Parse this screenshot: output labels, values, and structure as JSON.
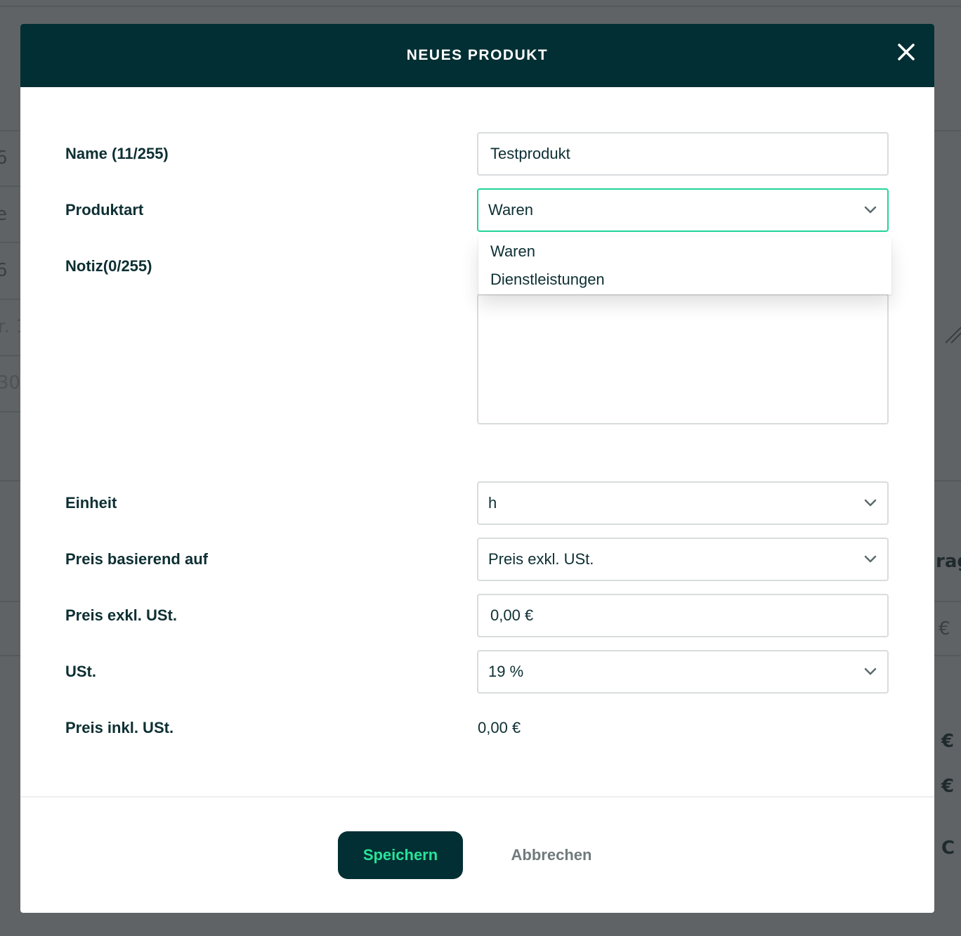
{
  "background": {
    "left_fragments": [
      "6",
      "e",
      "6",
      "lr. 1",
      "30"
    ],
    "right_fragments": [
      "rag",
      "€",
      "€",
      "€",
      "C"
    ]
  },
  "modal": {
    "title": "NEUES PRODUKT",
    "fields": {
      "name": {
        "label": "Name (11/255)",
        "value": "Testprodukt"
      },
      "produktart": {
        "label": "Produktart",
        "value": "Waren",
        "options": [
          "Waren",
          "Dienstleistungen"
        ]
      },
      "notiz": {
        "label": "Notiz(0/255)",
        "value": ""
      },
      "einheit": {
        "label": "Einheit",
        "value": "h"
      },
      "preis_basis": {
        "label": "Preis basierend auf",
        "value": "Preis exkl. USt."
      },
      "preis_exkl": {
        "label": "Preis exkl. USt.",
        "value": "0,00 €"
      },
      "ust": {
        "label": "USt.",
        "value": "19 %"
      },
      "preis_inkl": {
        "label": "Preis inkl. USt.",
        "value": "0,00 €"
      }
    },
    "buttons": {
      "save": "Speichern",
      "cancel": "Abbrechen"
    }
  },
  "colors": {
    "header_bg": "#022f33",
    "accent": "#27e39a",
    "focus_border": "#22d49a",
    "text": "#0d2f33"
  },
  "icons": {
    "close": "close-icon",
    "chevron": "chevron-down-icon"
  }
}
